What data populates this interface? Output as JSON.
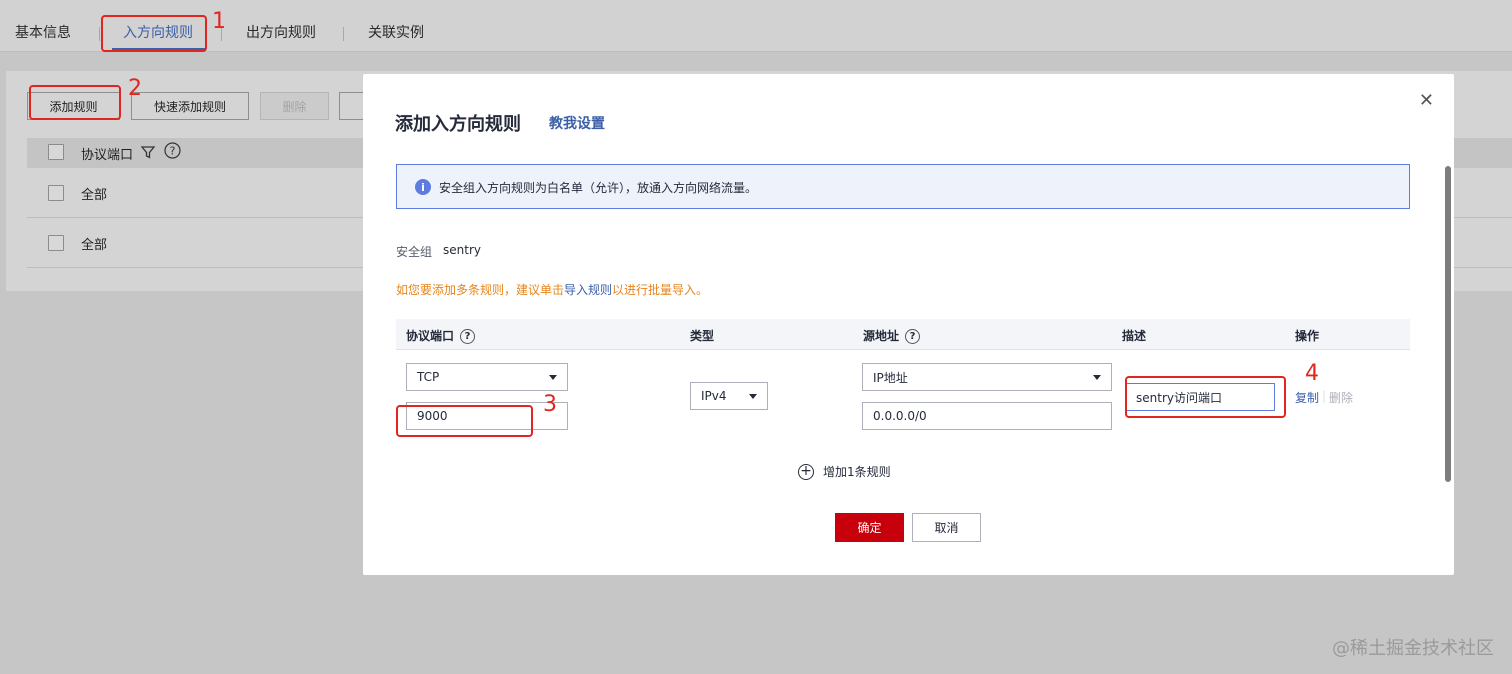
{
  "tabs": [
    "基本信息",
    "入方向规则",
    "出方向规则",
    "关联实例"
  ],
  "toolbar": {
    "add_rule": "添加规则",
    "quick_add": "快速添加规则",
    "delete": "删除"
  },
  "bg_table": {
    "header_col": "协议端口",
    "rows": [
      "全部",
      "全部"
    ]
  },
  "modal": {
    "title": "添加入方向规则",
    "help_link": "教我设置",
    "info": "安全组入方向规则为白名单（允许），放通入方向网络流量。",
    "security_group_label": "安全组",
    "security_group_value": "sentry",
    "warn_prefix": "如您要添加多条规则，建议单击",
    "warn_link": "导入规则",
    "warn_suffix": "以进行批量导入。",
    "columns": [
      "协议端口",
      "类型",
      "源地址",
      "描述",
      "操作"
    ],
    "row": {
      "protocol": "TCP",
      "port": "9000",
      "type": "IPv4",
      "source_type": "IP地址",
      "source": "0.0.0.0/0",
      "description": "sentry访问端口"
    },
    "row_actions": [
      "复制",
      "删除"
    ],
    "add_row": "增加1条规则",
    "ok": "确定",
    "cancel": "取消"
  },
  "annotations": [
    "1",
    "2",
    "3",
    "4"
  ],
  "watermark": "@稀土掘金技术社区",
  "colors": {
    "primary_button": "#c7000b",
    "link": "#3b5fa8",
    "annotation": "#e0261f",
    "warning": "#e8851c"
  }
}
